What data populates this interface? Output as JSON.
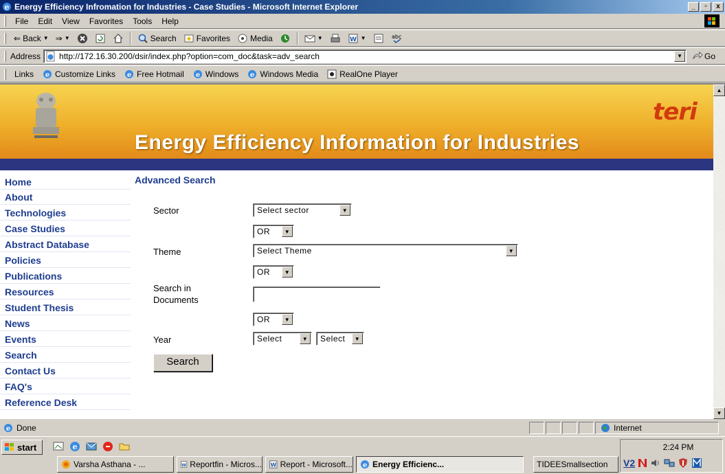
{
  "window": {
    "title": "Energy Efficiency Infromation for Industries - Case Studies - Microsoft Internet Explorer",
    "controls": [
      "_",
      "▫",
      "x"
    ]
  },
  "menu": [
    "File",
    "Edit",
    "View",
    "Favorites",
    "Tools",
    "Help"
  ],
  "toolbar": {
    "back_label": "Back",
    "search_label": "Search",
    "favorites_label": "Favorites",
    "media_label": "Media"
  },
  "address": {
    "label": "Address",
    "url": "http://172.16.30.200/dsir/index.php?option=com_doc&task=adv_search",
    "go_label": "Go"
  },
  "links": {
    "label": "Links",
    "items": [
      "Customize Links",
      "Free Hotmail",
      "Windows",
      "Windows Media",
      "RealOne Player"
    ]
  },
  "site": {
    "title": "Energy Efficiency Information for Industries",
    "logo_text": "teri"
  },
  "nav": [
    "Home",
    "About",
    "Technologies",
    "Case Studies",
    "Abstract Database",
    "Policies",
    "Publications",
    "Resources",
    "Student Thesis",
    "News",
    "Events",
    "Search",
    "Contact Us",
    "FAQ's",
    "Reference Desk"
  ],
  "form": {
    "heading": "Advanced Search",
    "sector_label": "Sector",
    "sector_value": "Select sector",
    "or_value": "OR",
    "theme_label": "Theme",
    "theme_value": "Select Theme",
    "search_docs_label_1": "Search in",
    "search_docs_label_2": "Documents",
    "search_docs_value": "",
    "year_label": "Year",
    "year_from_value": "Select",
    "year_to_value": "Select",
    "submit_label": "Search"
  },
  "status": {
    "text": "Done",
    "zone": "Internet"
  },
  "taskbar": {
    "start_label": "start",
    "tasks": [
      "Varsha Asthana - ...",
      "Reportfin - Micros...",
      "Report - Microsoft...",
      "Energy Efficienc...",
      "TIDEESmallsection"
    ],
    "clock": "2:24 PM",
    "tray_text": "V2"
  }
}
